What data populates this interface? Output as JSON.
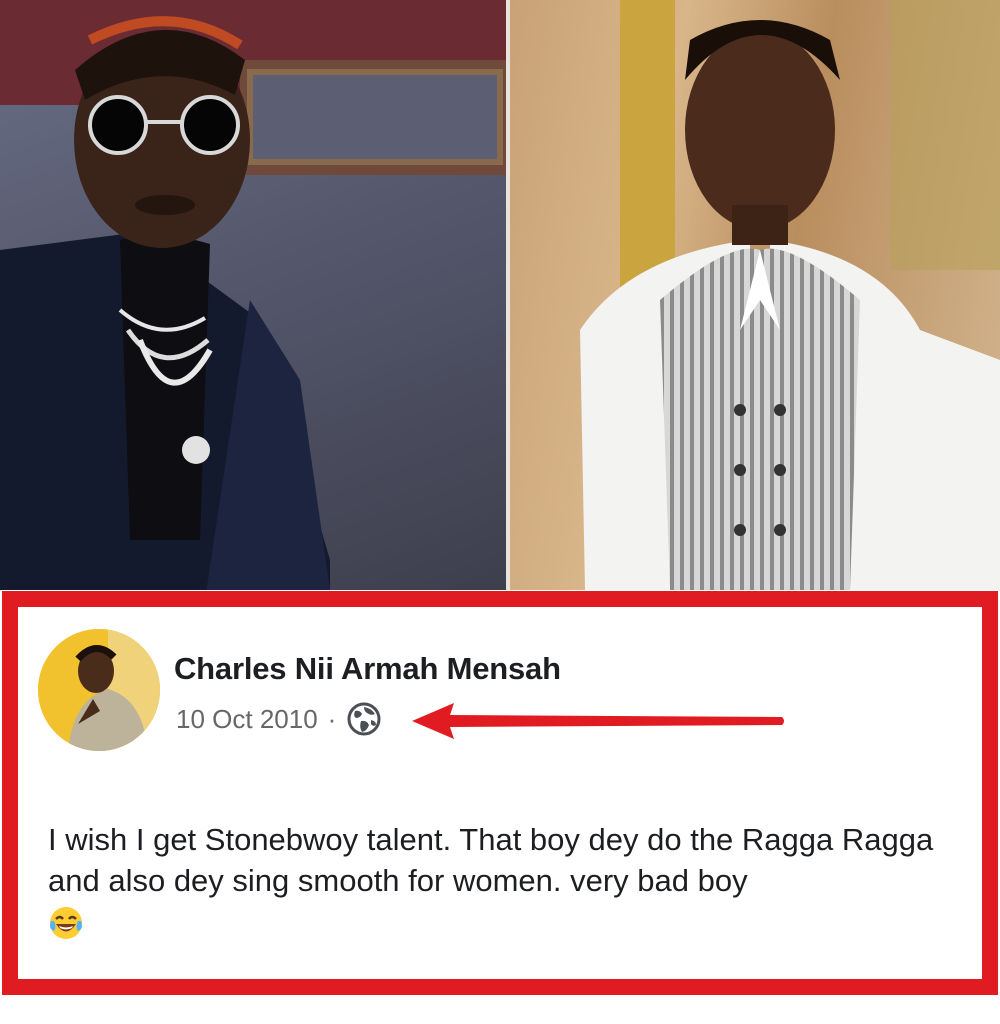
{
  "post": {
    "author_name": "Charles Nii Armah Mensah",
    "date": "10 Oct 2010",
    "separator": "·",
    "privacy_icon": "globe-icon",
    "body_text": "I wish I get Stonebwoy talent. That boy dey do the Ragga Ragga and also dey sing smooth for women. very bad boy",
    "emoji": "face-with-tears-of-joy"
  },
  "annotation": {
    "frame_color": "#e11b22",
    "arrow_color": "#e11b22",
    "arrow_icon": "arrow-left-icon"
  },
  "colors": {
    "name_text": "#1c1e21",
    "meta_text": "#65676b"
  }
}
